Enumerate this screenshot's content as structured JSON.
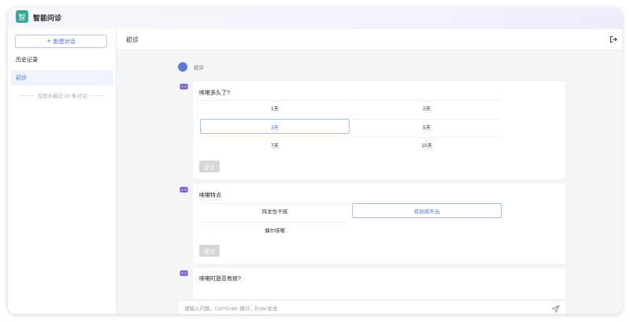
{
  "app": {
    "logo_char": "智",
    "title": "智能问诊"
  },
  "sidebar": {
    "new_chat_label": "新建对话",
    "history_title": "历史记录",
    "items": [
      {
        "label": "初诊"
      }
    ],
    "note": "仅显示最近 20 条对话"
  },
  "main": {
    "title": "初诊",
    "user_message": "初诊",
    "questions": [
      {
        "text": "咳嗽多久了?",
        "options": [
          "1天",
          "2天",
          "3天",
          "5天",
          "7天",
          "10天"
        ],
        "selected": "3天",
        "submit_label": "提交"
      },
      {
        "text": "咳嗽特点",
        "options": [
          "阵发性干咳",
          "有痰咳不出",
          "偶尔咳嗽"
        ],
        "selected": "有痰咳不出",
        "submit_label": "提交"
      },
      {
        "text": "咳嗽时是否有痰?",
        "options": []
      }
    ]
  },
  "input": {
    "placeholder": "请输入问题，Ctrl+Enter 换行，Enter发送"
  },
  "icons": {
    "logout": "logout-icon",
    "send": "send-icon",
    "bot": "robot-chat-icon",
    "plus": "plus-icon"
  },
  "colors": {
    "accent": "#4a73d6",
    "logo": "#3ea898",
    "bot": "#7b5fd6"
  }
}
